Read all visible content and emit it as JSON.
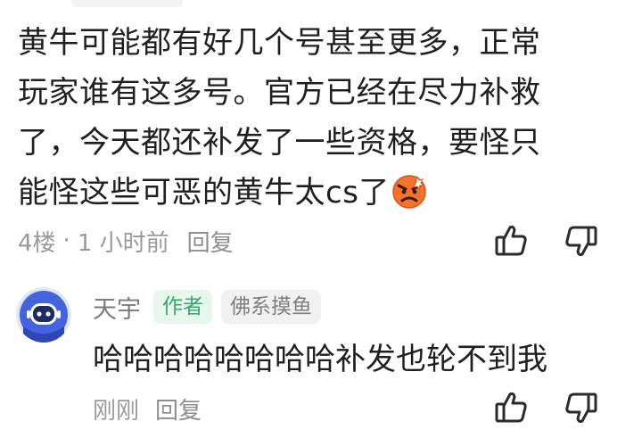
{
  "comment": {
    "lines": [
      "黄牛可能都有好几个号甚至更多，正常",
      "玩家谁有这多号。官方已经在尽力补救",
      "了，今天都还补发了一些资格，要怪只",
      "能怪这些可恶的黄牛太cs了"
    ],
    "emoji": "angry-face-emoji",
    "floor": "4楼",
    "separator": "·",
    "time": "1 小时前",
    "reply_label": "回复"
  },
  "reply": {
    "username": "天宇",
    "author_badge": "作者",
    "tag_badge": "佛系摸鱼",
    "text": "哈哈哈哈哈哈哈哈补发也轮不到我",
    "time": "刚刚",
    "reply_label": "回复"
  },
  "icons": {
    "like": "thumbs-up-icon",
    "dislike": "thumbs-down-icon"
  },
  "colors": {
    "text": "#1f1f1f",
    "meta": "#9a9a9a",
    "author_badge_text": "#3ba56b",
    "author_badge_bg": "#e8f7ee",
    "tag_badge_bg": "#f1f1f1",
    "emoji_orange": "#f4732d",
    "avatar_blue": "#3f5fd8"
  }
}
